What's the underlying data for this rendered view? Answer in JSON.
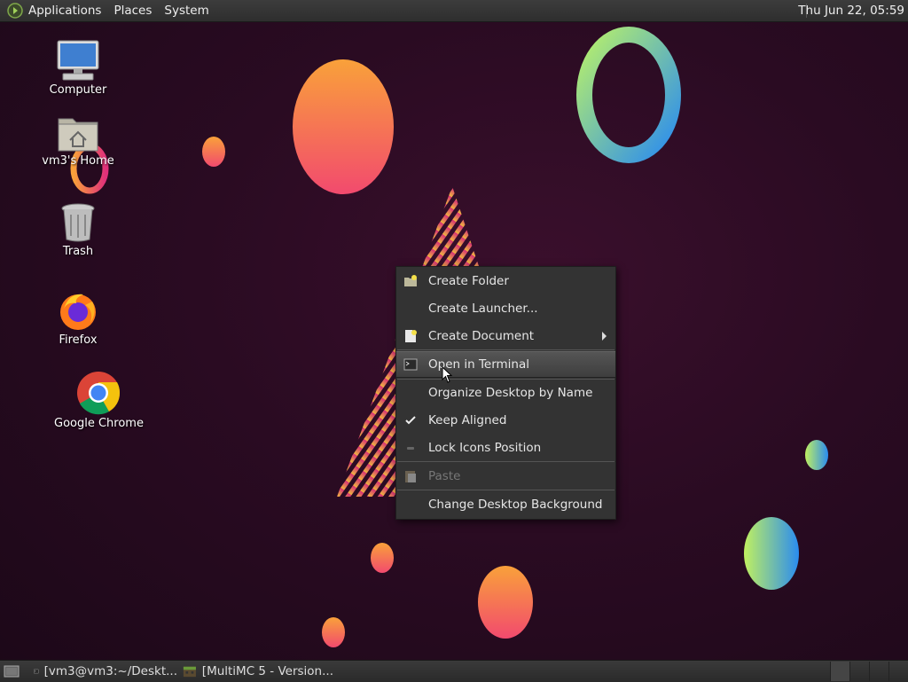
{
  "top_panel": {
    "menus": [
      "Applications",
      "Places",
      "System"
    ],
    "clock": "Thu Jun 22, 05:59"
  },
  "desktop_icons": [
    {
      "label": "Computer",
      "icon": "computer-icon"
    },
    {
      "label": "vm3's Home",
      "icon": "home-folder-icon"
    },
    {
      "label": "Trash",
      "icon": "trash-icon"
    },
    {
      "label": "Firefox",
      "icon": "firefox-icon"
    },
    {
      "label": "Google Chrome",
      "icon": "chrome-icon"
    }
  ],
  "context_menu": {
    "items": [
      {
        "label": "Create Folder",
        "icon": "folder-new-icon"
      },
      {
        "label": "Create Launcher...",
        "icon": ""
      },
      {
        "label": "Create Document",
        "icon": "document-new-icon",
        "submenu": true
      },
      {
        "label": "Open in Terminal",
        "icon": "terminal-icon",
        "highlighted": true
      },
      {
        "label": "Organize Desktop by Name",
        "icon": ""
      },
      {
        "label": "Keep Aligned",
        "icon": "check-icon",
        "checked": true
      },
      {
        "label": "Lock Icons Position",
        "icon": "unchecked-dash-icon",
        "checked": false
      },
      {
        "label": "Paste",
        "icon": "paste-icon",
        "disabled": true
      },
      {
        "label": "Change Desktop Background",
        "icon": ""
      }
    ]
  },
  "bottom_panel": {
    "tasks": [
      {
        "label": "[vm3@vm3:~/Deskt...",
        "icon": "terminal-icon"
      },
      {
        "label": "[MultiMC 5 - Version...",
        "icon": "multimc-icon"
      }
    ]
  },
  "colors": {
    "panel_bg": "#333333",
    "menu_bg": "#333333",
    "desktop_bg": "#2a0b22"
  }
}
